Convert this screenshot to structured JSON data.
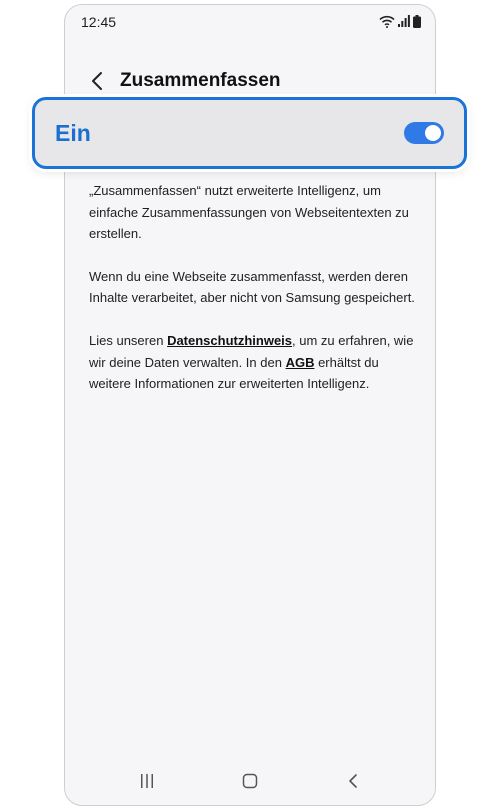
{
  "status_bar": {
    "time": "12:45",
    "icons": [
      "wifi-icon",
      "signal-icon",
      "battery-icon"
    ]
  },
  "header": {
    "back_icon": "chevron-left-icon",
    "title": "Zusammenfassen"
  },
  "toggle": {
    "label": "Ein",
    "state": "on",
    "accent_color": "#1a74d8"
  },
  "description": {
    "p1": "„Zusammenfassen“ nutzt erweiterte Intelligenz, um einfache Zusammenfassungen von Webseitentexten zu erstellen.",
    "p2": "Wenn du eine Webseite zusammenfasst, werden deren Inhalte verarbeitet, aber nicht von Samsung gespeichert.",
    "p3_before": "Lies unseren ",
    "p3_link1": "Datenschutzhinweis",
    "p3_middle": ", um zu erfahren, wie wir deine Daten verwalten. In den ",
    "p3_link2": "AGB",
    "p3_after": " erhältst du weitere Informationen zur erweiterten Intelligenz."
  },
  "nav_bar": {
    "recents_icon": "recents-icon",
    "home_icon": "home-icon",
    "back_icon": "back-icon"
  }
}
